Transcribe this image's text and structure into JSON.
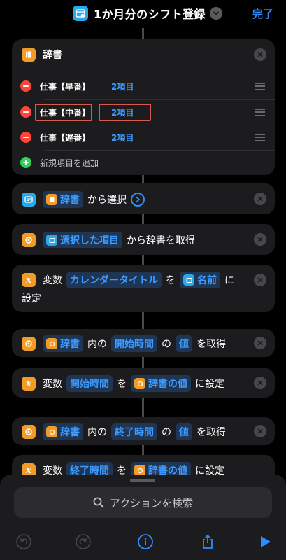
{
  "header": {
    "title": "1か月分のシフト登録",
    "done_label": "完了"
  },
  "dictionary": {
    "title": "辞書",
    "items": [
      {
        "key": "仕事【早番】",
        "value": "2項目"
      },
      {
        "key": "仕事【中番】",
        "value": "2項目"
      },
      {
        "key": "仕事【遅番】",
        "value": "2項目"
      }
    ],
    "add_label": "新規項目を追加"
  },
  "actions": {
    "choose": {
      "token": "辞書",
      "text": "から選択"
    },
    "get_dict": {
      "token": "選択した項目",
      "text": "から辞書を取得"
    },
    "set_var1": {
      "prefix": "変数",
      "var": "カレンダータイトル",
      "to": "を",
      "token": "名前",
      "suffix": "に",
      "line2": "設定"
    },
    "get_start": {
      "token": "辞書",
      "in": "内の",
      "key": "開始時間",
      "of": "の",
      "val": "値",
      "suffix": "を取得"
    },
    "set_var2": {
      "prefix": "変数",
      "var": "開始時間",
      "to": "を",
      "token": "辞書の値",
      "suffix": "に設定"
    },
    "get_end": {
      "token": "辞書",
      "in": "内の",
      "key": "終了時間",
      "of": "の",
      "val": "値",
      "suffix": "を取得"
    },
    "set_var3": {
      "prefix": "変数",
      "var": "終了時間",
      "to": "を",
      "token": "辞書の値",
      "suffix": "に設定"
    }
  },
  "search": {
    "placeholder": "アクションを検索"
  },
  "colors": {
    "accent": "#2f8cff",
    "orange": "#f29b26",
    "cyan": "#2aa8e8",
    "red": "#ff453a",
    "green": "#30d158",
    "highlight": "#d65a4e"
  }
}
